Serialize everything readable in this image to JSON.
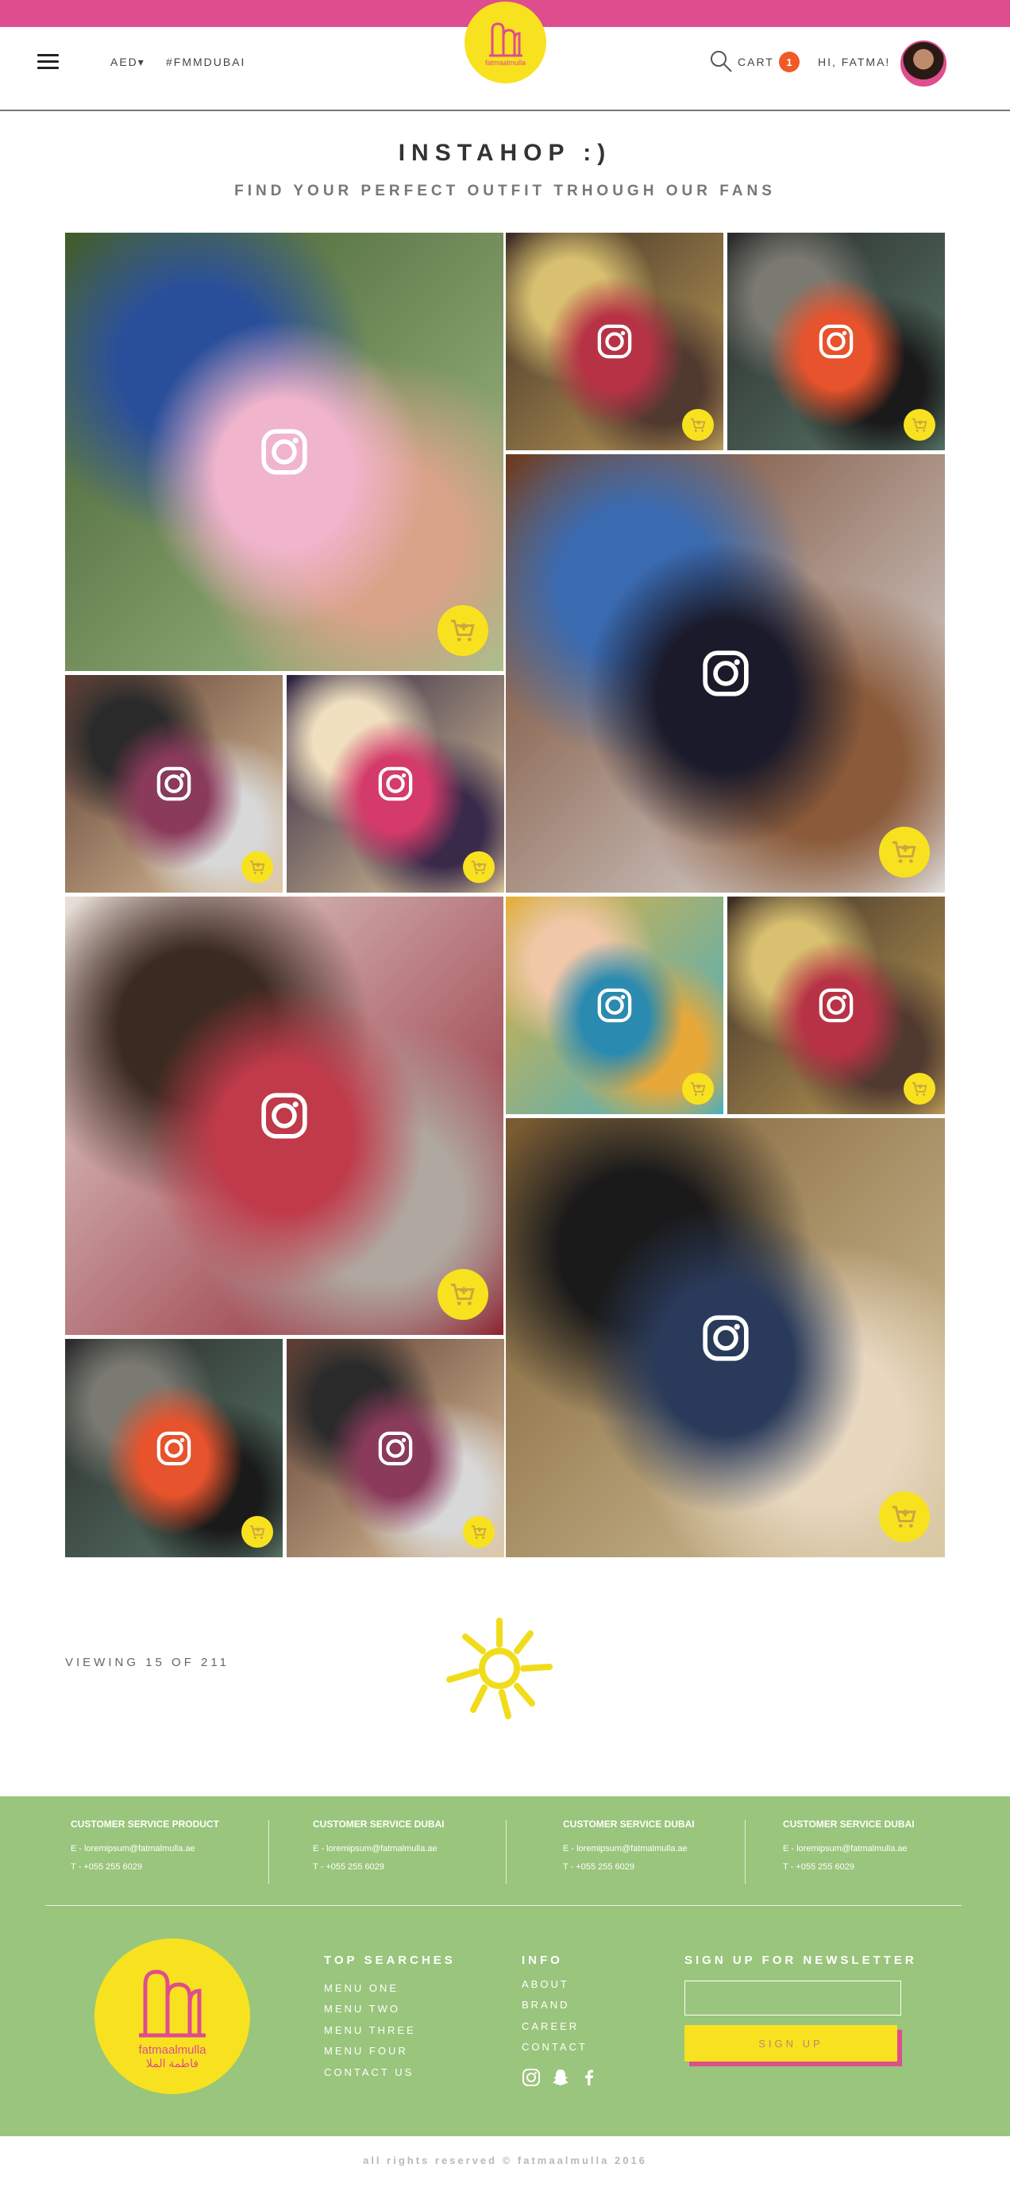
{
  "header": {
    "currency": "AED",
    "hashtag": "#FMMDUBAI",
    "logo_text": "fatmaalmulla",
    "cart_label": "CART",
    "cart_count": "1",
    "greeting": "HI, FATMA!"
  },
  "main": {
    "title": "INSTAHOP :)",
    "subtitle": "FIND YOUR PERFECT OUTFIT TRHOUGH OUR FANS",
    "viewing": "VIEWING 15 OF 211"
  },
  "colors": {
    "pink": "#de4d8e",
    "yellow": "#f8e21f",
    "green": "#9ac57c",
    "orange": "#f15a24"
  },
  "tiles": [
    {
      "name": "photo-pink-phone-case",
      "colors": [
        "#3f5a2c",
        "#a8c38c",
        "#f0b4cc",
        "#2a4f9a",
        "#d9a38a"
      ]
    },
    {
      "name": "photo-two-women-restaurant",
      "colors": [
        "#3a2c24",
        "#c4a25a",
        "#b83245",
        "#d8c070",
        "#503a30"
      ]
    },
    {
      "name": "photo-orange-bag",
      "colors": [
        "#2a2a2a",
        "#5a7a6a",
        "#e6532c",
        "#7a7a72",
        "#1a1a1a"
      ]
    },
    {
      "name": "photo-two-women-door",
      "colors": [
        "#6a3a20",
        "#e8e8e8",
        "#1a1a2a",
        "#3a6ab0",
        "#8a5a3a"
      ]
    },
    {
      "name": "photo-hijab-pair",
      "colors": [
        "#5a3a30",
        "#e4c8a0",
        "#8a3a5a",
        "#2a2a2a",
        "#d8d8d8"
      ]
    },
    {
      "name": "photo-mirror-collage",
      "colors": [
        "#2a2040",
        "#e8d0a0",
        "#d43a6a",
        "#f0e0c0",
        "#3a2a4a"
      ]
    },
    {
      "name": "photo-red-kaftan",
      "colors": [
        "#e8e0d8",
        "#8a1a2a",
        "#c03a4a",
        "#3a2a20",
        "#b0a8a0"
      ]
    },
    {
      "name": "photo-blue-hijab",
      "colors": [
        "#e8b038",
        "#3ab0d0",
        "#2a8ab0",
        "#f0c8a8",
        "#e8a838"
      ]
    },
    {
      "name": "photo-two-women-restaurant-2",
      "colors": [
        "#3a2c24",
        "#c4a25a",
        "#b83245",
        "#d8c070",
        "#503a30"
      ]
    },
    {
      "name": "photo-mirror-hall",
      "colors": [
        "#7a5a30",
        "#d8c8a0",
        "#2a3a5a",
        "#1a1a1a",
        "#e8d8c0"
      ]
    },
    {
      "name": "photo-orange-bag-2",
      "colors": [
        "#2a2a2a",
        "#5a7a6a",
        "#e6532c",
        "#7a7a72",
        "#1a1a1a"
      ]
    },
    {
      "name": "photo-hijab-pair-2",
      "colors": [
        "#5a3a30",
        "#e4c8a0",
        "#8a3a5a",
        "#2a2a2a",
        "#d8d8d8"
      ]
    }
  ],
  "footer": {
    "service": [
      {
        "heading": "CUSTOMER SERVICE PRODUCT",
        "email": "E - loremipsum@fatmalmulla.ae",
        "phone": "T - +055 255 6029"
      },
      {
        "heading": "CUSTOMER SERVICE DUBAI",
        "email": "E - loremipsum@fatmalmulla.ae",
        "phone": "T - +055 255 6029"
      },
      {
        "heading": "CUSTOMER SERVICE DUBAI",
        "email": "E - loremipsum@fatmalmulla.ae",
        "phone": "T - +055 255 6029"
      },
      {
        "heading": "CUSTOMER SERVICE DUBAI",
        "email": "E - loremipsum@fatmalmulla.ae",
        "phone": "T - +055 255 6029"
      }
    ],
    "logo_text": "fatmaalmulla",
    "logo_text_ar": "فاطمة الملا",
    "top_searches_heading": "TOP SEARCHES",
    "top_searches": [
      "MENU ONE",
      "MENU TWO",
      "MENU THREE",
      "MENU FOUR",
      "CONTACT US"
    ],
    "info_heading": "INFO",
    "info_links": [
      "ABOUT",
      "BRAND",
      "CAREER",
      "CONTACT"
    ],
    "social_icons": [
      "instagram-icon",
      "snapchat-icon",
      "facebook-icon"
    ],
    "newsletter_heading": "SIGN UP FOR NEWSLETTER",
    "newsletter_button": "SIGN UP",
    "copyright": "all rights reserved © fatmaalmulla 2016"
  }
}
